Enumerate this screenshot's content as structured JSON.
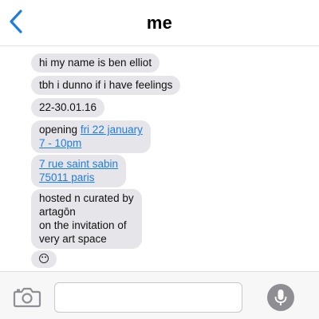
{
  "header": {
    "title": "me",
    "back_icon": "chevron-left-icon",
    "accent_color": "#1e7ee0"
  },
  "messages": [
    {
      "text": "hi my name is ben elliot"
    },
    {
      "text": "tbh i dunno if i have feelings"
    },
    {
      "text": "22-30.01.16"
    },
    {
      "prefix": "opening ",
      "link_line1": "fri 22 january",
      "link_line2": "7 - 10pm"
    },
    {
      "link_line1": "7 rue saint sabin",
      "link_line2": "75011 paris"
    },
    {
      "lines": [
        "hosted n curated by",
        "artagōn",
        "on the invitation of",
        "very art space"
      ]
    },
    {
      "emoji": "😶"
    }
  ],
  "composer": {
    "placeholder": "",
    "camera_icon": "camera-icon",
    "mic_icon": "microphone-icon"
  },
  "colors": {
    "bubble": "#e5e5ea",
    "link": "#1e7ee0"
  }
}
